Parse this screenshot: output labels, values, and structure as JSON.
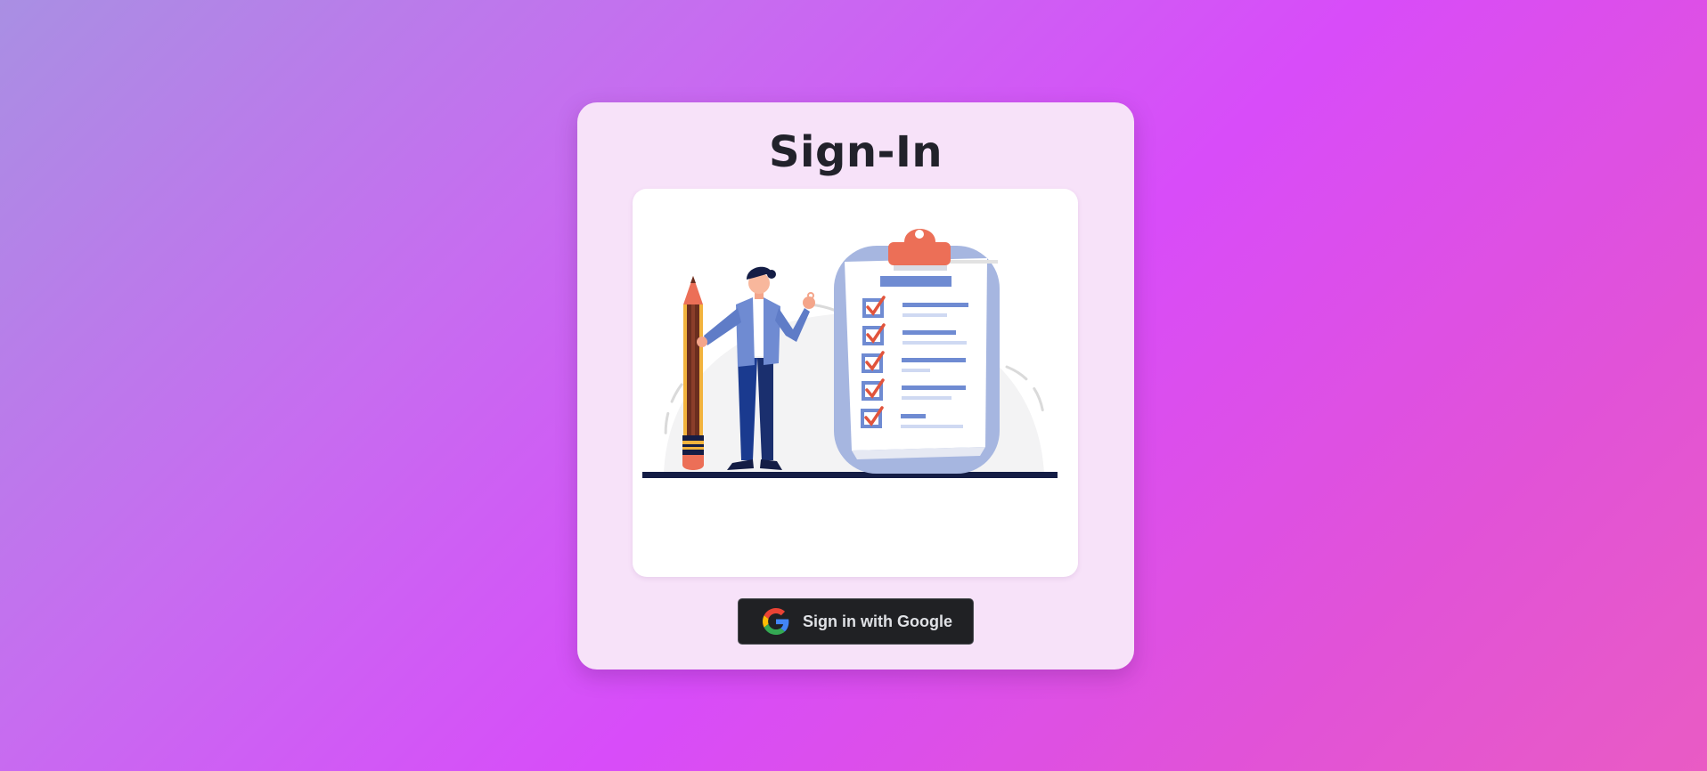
{
  "page": {
    "title": "Sign-In"
  },
  "illustration": {
    "icon": "person-with-pencil-and-checklist-illustration"
  },
  "google_button": {
    "label": "Sign in with Google",
    "icon": "google-g-icon"
  },
  "colors": {
    "background_gradient": [
      "#a98fe3",
      "#d84cf9",
      "#e95bc4"
    ],
    "card": "#f7e2f9",
    "button_bg": "#202124",
    "button_text": "#dfe1e5",
    "title_text": "#22222b"
  }
}
